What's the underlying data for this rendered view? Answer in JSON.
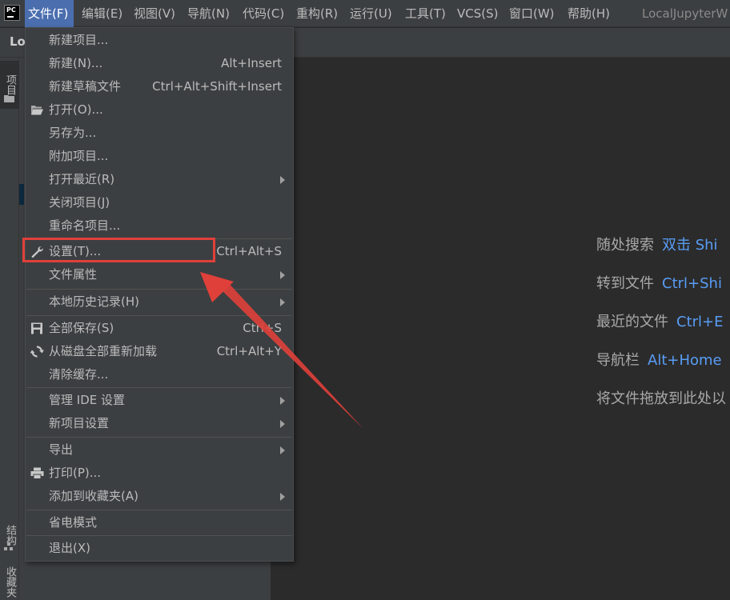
{
  "app": {
    "logo_text": "PC",
    "window_title": "LocalJupyterW",
    "project_crumb": "Loc"
  },
  "menubar": {
    "items": [
      {
        "label": "文件(F)",
        "active": true
      },
      {
        "label": "编辑(E)"
      },
      {
        "label": "视图(V)"
      },
      {
        "label": "导航(N)"
      },
      {
        "label": "代码(C)"
      },
      {
        "label": "重构(R)"
      },
      {
        "label": "运行(U)"
      },
      {
        "label": "工具(T)"
      },
      {
        "label": "VCS(S)"
      },
      {
        "label": "窗口(W)"
      },
      {
        "label": "帮助(H)"
      }
    ]
  },
  "tool_strip": {
    "project_label": "项目",
    "structure_label": "结构",
    "favorites_label": "收藏夹"
  },
  "file_menu": {
    "items": [
      {
        "label": "新建项目...",
        "shortcut": "",
        "submenu": false,
        "icon": ""
      },
      {
        "label": "新建(N)...",
        "shortcut": "Alt+Insert",
        "submenu": false,
        "icon": ""
      },
      {
        "label": "新建草稿文件",
        "shortcut": "Ctrl+Alt+Shift+Insert",
        "submenu": false,
        "icon": ""
      },
      {
        "label": "打开(O)...",
        "shortcut": "",
        "submenu": false,
        "icon": "folder-open-icon"
      },
      {
        "label": "另存为...",
        "shortcut": "",
        "submenu": false,
        "icon": ""
      },
      {
        "label": "附加项目...",
        "shortcut": "",
        "submenu": false,
        "icon": ""
      },
      {
        "label": "打开最近(R)",
        "shortcut": "",
        "submenu": true,
        "icon": ""
      },
      {
        "label": "关闭项目(J)",
        "shortcut": "",
        "submenu": false,
        "icon": ""
      },
      {
        "label": "重命名项目...",
        "shortcut": "",
        "submenu": false,
        "icon": ""
      },
      {
        "label": "设置(T)...",
        "shortcut": "Ctrl+Alt+S",
        "submenu": false,
        "icon": "wrench-icon"
      },
      {
        "label": "文件属性",
        "shortcut": "",
        "submenu": true,
        "icon": ""
      },
      {
        "label": "本地历史记录(H)",
        "shortcut": "",
        "submenu": true,
        "icon": ""
      },
      {
        "label": "全部保存(S)",
        "shortcut": "Ctrl+S",
        "submenu": false,
        "icon": "save-icon"
      },
      {
        "label": "从磁盘全部重新加载",
        "shortcut": "Ctrl+Alt+Y",
        "submenu": false,
        "icon": "reload-icon"
      },
      {
        "label": "清除缓存...",
        "shortcut": "",
        "submenu": false,
        "icon": ""
      },
      {
        "label": "管理 IDE 设置",
        "shortcut": "",
        "submenu": true,
        "icon": ""
      },
      {
        "label": "新项目设置",
        "shortcut": "",
        "submenu": true,
        "icon": ""
      },
      {
        "label": "导出",
        "shortcut": "",
        "submenu": true,
        "icon": ""
      },
      {
        "label": "打印(P)...",
        "shortcut": "",
        "submenu": false,
        "icon": "print-icon"
      },
      {
        "label": "添加到收藏夹(A)",
        "shortcut": "",
        "submenu": true,
        "icon": ""
      },
      {
        "label": "省电模式",
        "shortcut": "",
        "submenu": false,
        "icon": ""
      },
      {
        "label": "退出(X)",
        "shortcut": "",
        "submenu": false,
        "icon": ""
      }
    ]
  },
  "editor_hints": [
    {
      "label": "随处搜索",
      "key": "双击 Shi"
    },
    {
      "label": "转到文件",
      "key": "Ctrl+Shi"
    },
    {
      "label": "最近的文件",
      "key": "Ctrl+E"
    },
    {
      "label": "导航栏",
      "key": "Alt+Home"
    },
    {
      "label": "将文件拖放到此处以",
      "key": ""
    }
  ],
  "colors": {
    "menu_bg": "#3c3f41",
    "active_menu": "#4b6eaf",
    "editor_bg": "#2b2b2b",
    "hint_key": "#589df6",
    "annotation": "#e0403a"
  }
}
